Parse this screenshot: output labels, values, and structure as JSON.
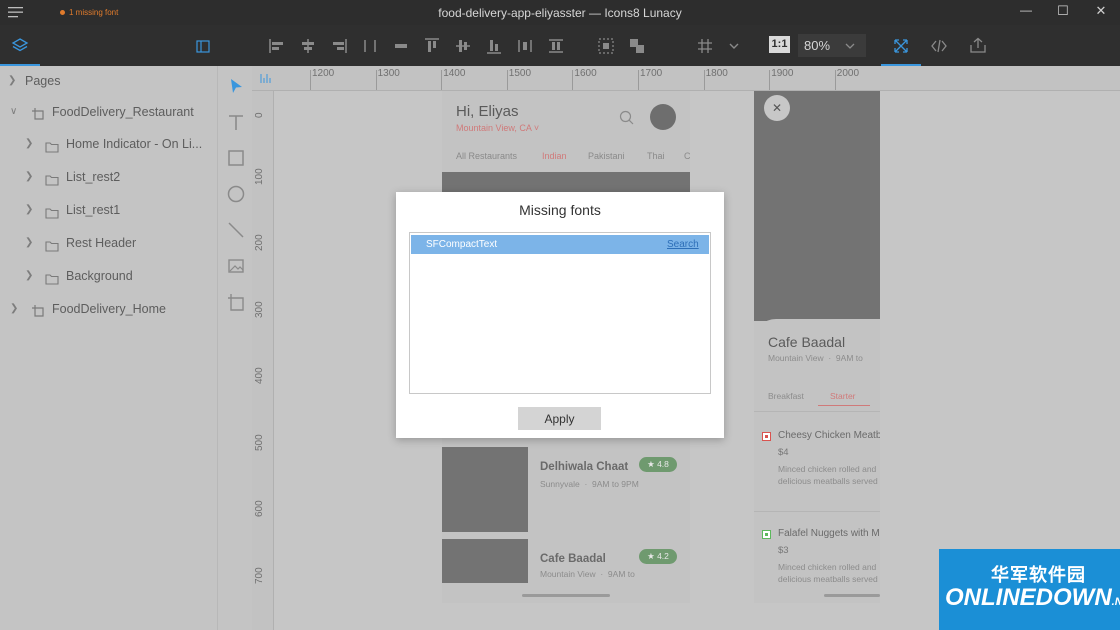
{
  "window": {
    "title": "food-delivery-app-eliyasster — Icons8 Lunacy",
    "missing_font_notice": "1 missing font",
    "controls": {
      "minimize": "—",
      "maximize": "☐",
      "close": "✕"
    }
  },
  "toolbar": {
    "zoom": "80%",
    "actual_size": "1:1"
  },
  "layers": {
    "pages_label": "Pages",
    "items": [
      {
        "label": "FoodDelivery_Restaurant",
        "type": "artboard",
        "expanded": true
      },
      {
        "label": "Home Indicator - On Li...",
        "type": "group"
      },
      {
        "label": "List_rest2",
        "type": "group"
      },
      {
        "label": "List_rest1",
        "type": "group"
      },
      {
        "label": "Rest Header",
        "type": "group"
      },
      {
        "label": "Background",
        "type": "group"
      },
      {
        "label": "FoodDelivery_Home",
        "type": "artboard",
        "expanded": false
      }
    ]
  },
  "ruler": {
    "h_ticks": [
      "1200",
      "1300",
      "1400",
      "1500",
      "1600",
      "1700",
      "1800",
      "1900",
      "2000"
    ],
    "v_ticks": [
      "0",
      "100",
      "200",
      "300",
      "400",
      "500",
      "600",
      "700"
    ]
  },
  "artboard_home": {
    "greeting": "Hi, Eliyas",
    "location": "Mountain View, CA",
    "location_caret": "˅",
    "tabs": [
      "All Restaurants",
      "Indian",
      "Pakistani",
      "Thai",
      "C"
    ],
    "cards": [
      {
        "name": "Delhiwala Chaat",
        "rating": "★ 4.8",
        "sub": "Sunnyvale",
        "dot": "·",
        "hours": "9AM to 9PM"
      },
      {
        "name": "Cafe Baadal",
        "rating": "★ 4.2",
        "sub": "Mountain View",
        "dot": "·",
        "hours": "9AM to"
      }
    ]
  },
  "artboard_restaurant": {
    "close_glyph": "✕",
    "name": "Cafe Baadal",
    "sub": "Mountain View",
    "dot": "·",
    "hours": "9AM to",
    "tabs": [
      "Breakfast",
      "Starter"
    ],
    "items": [
      {
        "name": "Cheesy Chicken Meatb",
        "price": "$4",
        "desc1": "Minced chicken rolled and",
        "desc2": "delicious meatballs served"
      },
      {
        "name": "Falafel Nuggets with M",
        "price": "$3",
        "desc1": "Minced chicken rolled and",
        "desc2": "delicious meatballs served"
      }
    ]
  },
  "dialog": {
    "title": "Missing fonts",
    "fonts": [
      {
        "name": "SFCompactText",
        "action": "Search"
      }
    ],
    "apply_label": "Apply"
  },
  "watermark": {
    "cn_text": "华军软件园",
    "en_text": "ONLINEDOWN",
    "suffix": ".NET"
  },
  "colors": {
    "accent": "#3a96dd",
    "selection": "#7cb4e8",
    "red": "#d9534f",
    "green": "#5cb85c",
    "watermark_bg": "#1b8fd6"
  }
}
